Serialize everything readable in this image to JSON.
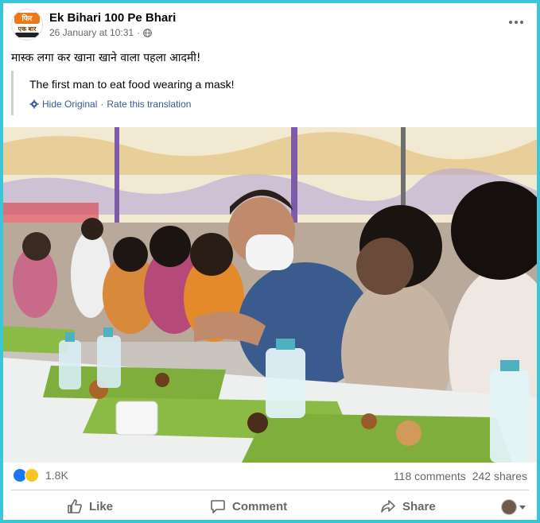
{
  "post": {
    "page_name": "Ek Bihari 100 Pe Bhari",
    "logo_text_top": "फिर",
    "logo_text_mid": "एक बार",
    "timestamp": "26 January at 10:31",
    "separator": "·",
    "audience_icon": "globe-icon",
    "caption": "मास्क लगा कर खाना  खाने वाला पहला आदमी!",
    "translation": {
      "text": "The first man to eat food wearing a mask!",
      "hide_label": "Hide Original",
      "dot": "·",
      "rate_label": "Rate this translation"
    }
  },
  "stats": {
    "reaction_icons": [
      "like-icon",
      "haha-icon"
    ],
    "reaction_count": "1.8K",
    "comments": "118 comments",
    "shares": "242 shares"
  },
  "actions": {
    "like": "Like",
    "comment": "Comment",
    "share": "Share"
  },
  "colors": {
    "frame": "#39c7d8",
    "link": "#385898",
    "secondary_text": "#65676b",
    "like_blue": "#1877f2",
    "banana_leaf": "#7fae3c"
  }
}
